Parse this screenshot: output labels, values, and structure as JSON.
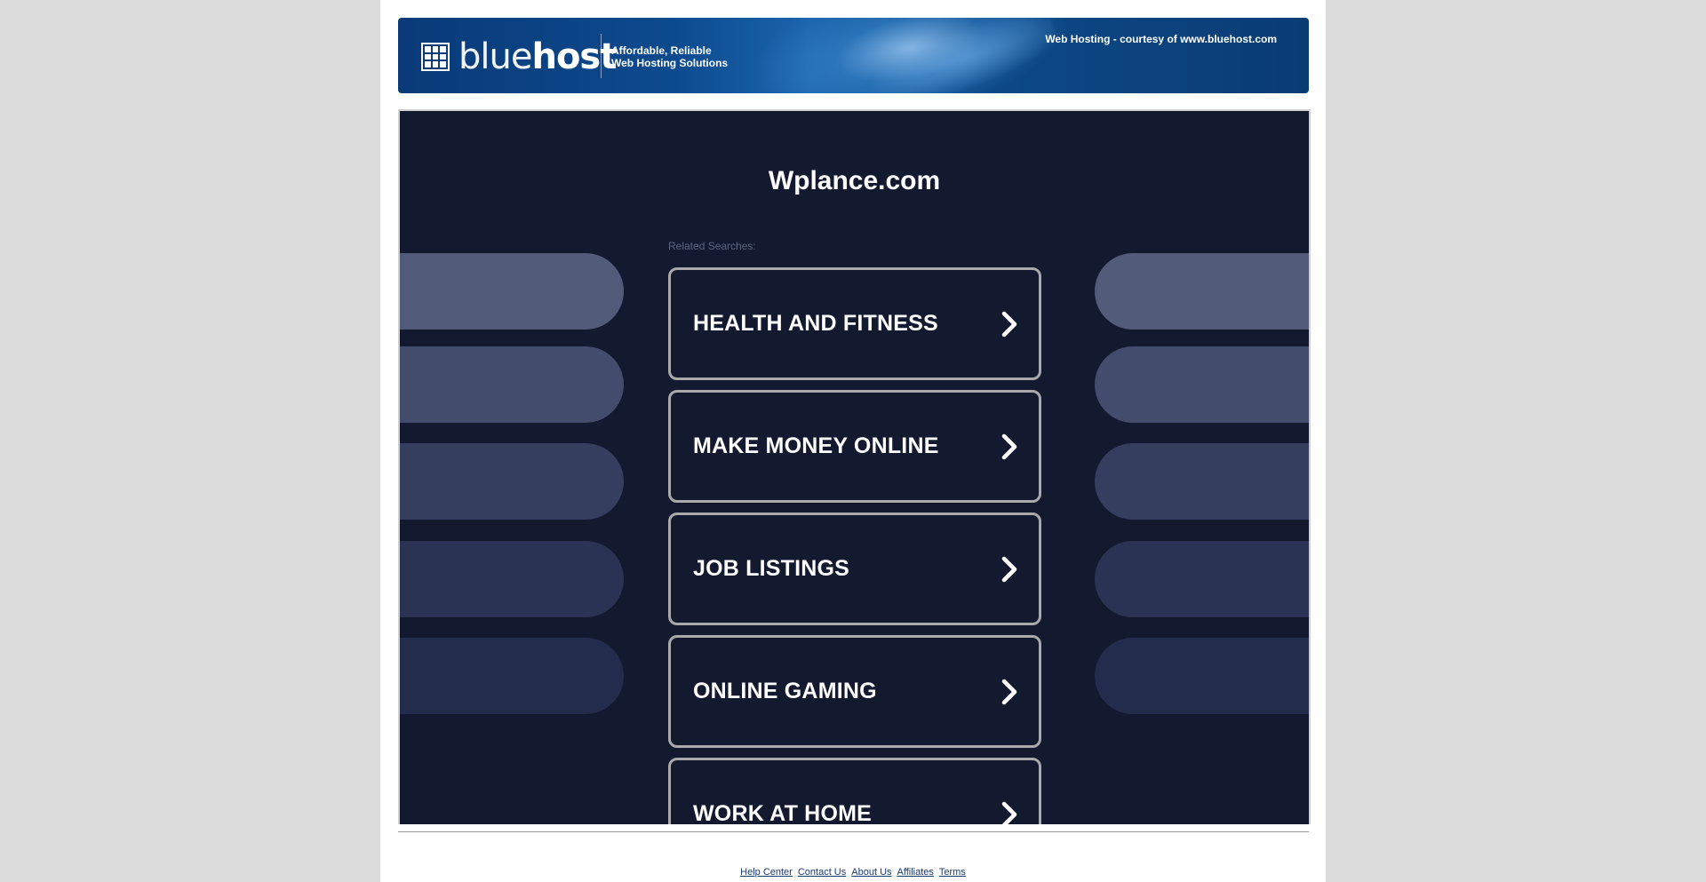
{
  "header": {
    "logo_bold": "blue",
    "logo_light": "host",
    "tagline_line1": "Affordable, Reliable",
    "tagline_line2": "Web Hosting Solutions",
    "courtesy": "Web Hosting - courtesy of www.bluehost.com"
  },
  "main": {
    "domain": "Wplance.com",
    "related_label": "Related Searches:",
    "searches": [
      {
        "label": "HEALTH AND FITNESS"
      },
      {
        "label": "MAKE MONEY ONLINE"
      },
      {
        "label": "JOB LISTINGS"
      },
      {
        "label": "ONLINE GAMING"
      },
      {
        "label": "WORK AT HOME"
      }
    ]
  },
  "footer": {
    "links": [
      "Help Center",
      "Contact Us",
      "About Us",
      "Affiliates",
      "Terms"
    ]
  },
  "colors": {
    "panel_bg": "#131a30",
    "banner_blue": "#0c4a8e",
    "pill_colors": [
      "#525b7a",
      "#434c6c",
      "#353e5e",
      "#2a3354",
      "#232c4c"
    ]
  }
}
